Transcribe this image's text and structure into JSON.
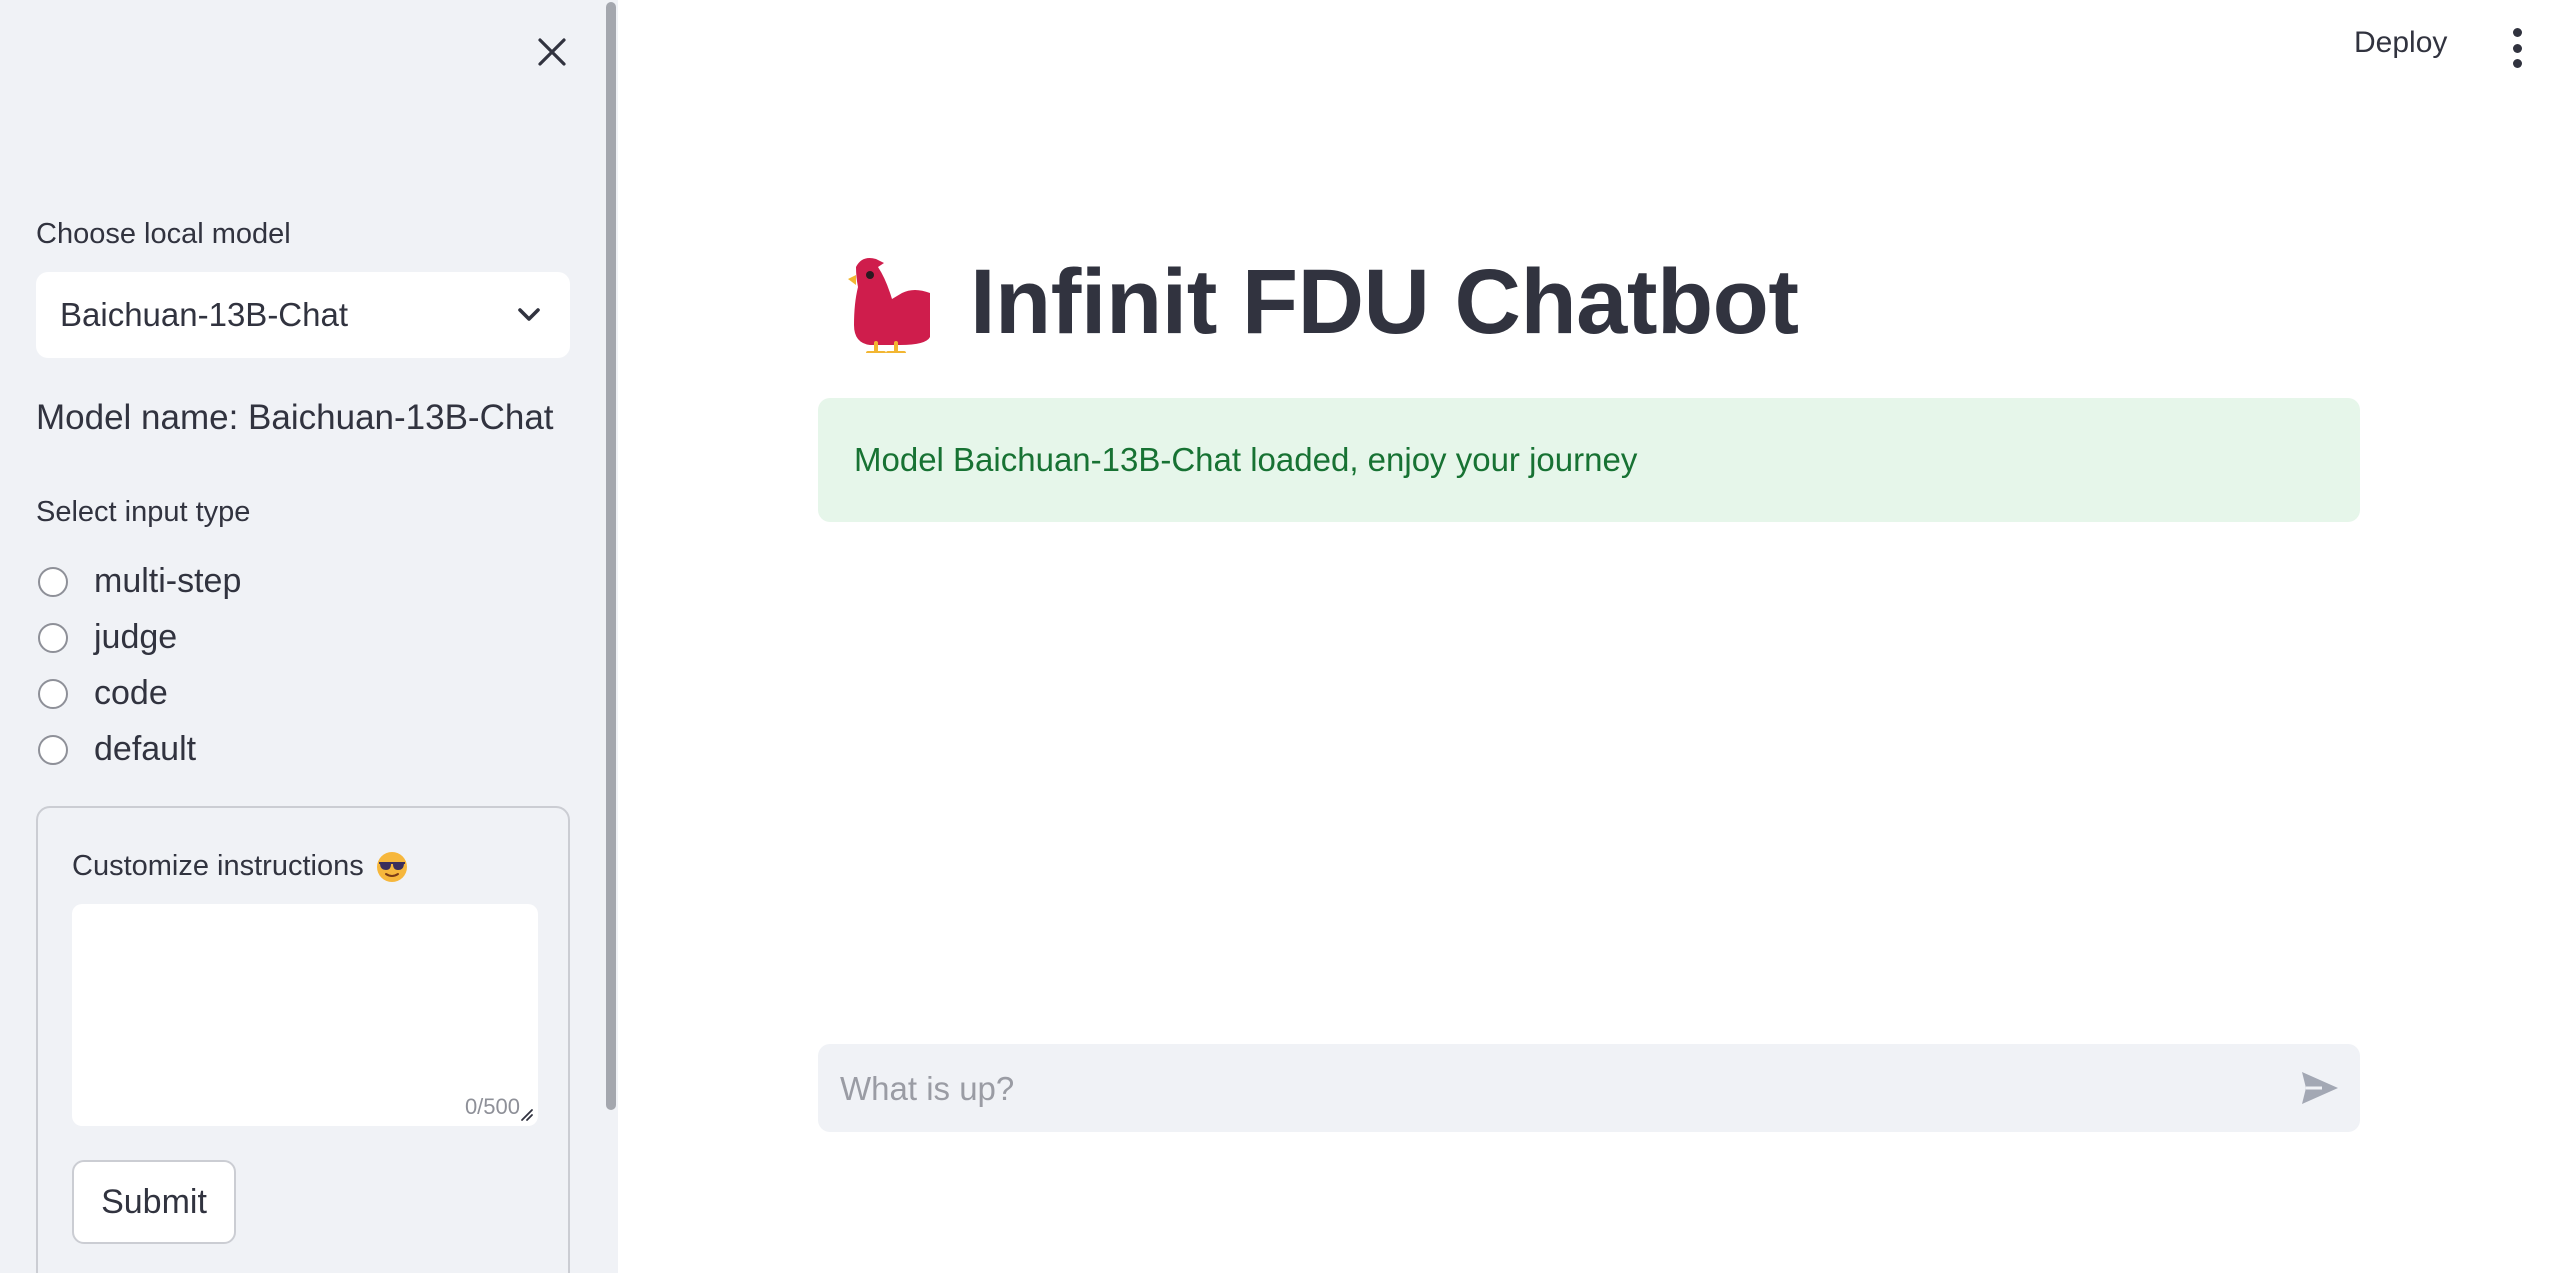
{
  "sidebar": {
    "close_icon": "close-icon",
    "model_select": {
      "label": "Choose local model",
      "selected": "Baichuan-13B-Chat",
      "icon": "chevron-down-icon"
    },
    "model_name_text": "Model name: Baichuan-13B-Chat",
    "input_type": {
      "label": "Select input type",
      "options": [
        "multi-step",
        "judge",
        "code",
        "default"
      ]
    },
    "instructions_form": {
      "label": "Customize instructions",
      "label_icon": "sunglasses-emoji-icon",
      "textarea_value": "",
      "char_count": "0/500",
      "submit_label": "Submit"
    }
  },
  "header": {
    "deploy_label": "Deploy",
    "menu_icon": "more-vertical-icon"
  },
  "main": {
    "title_icon": "bird-emoji-icon",
    "title": "Infinit FDU Chatbot",
    "alert_text": "Model Baichuan-13B-Chat loaded, enjoy your journey",
    "chat_input": {
      "placeholder": "What is up?",
      "value": "",
      "send_icon": "send-icon"
    }
  },
  "colors": {
    "sidebar_bg": "#f0f2f6",
    "alert_bg": "#e6f6ea",
    "alert_text": "#177233",
    "text": "#31333f",
    "bird": "#cf1d4c",
    "bird_feet": "#f2b632"
  }
}
